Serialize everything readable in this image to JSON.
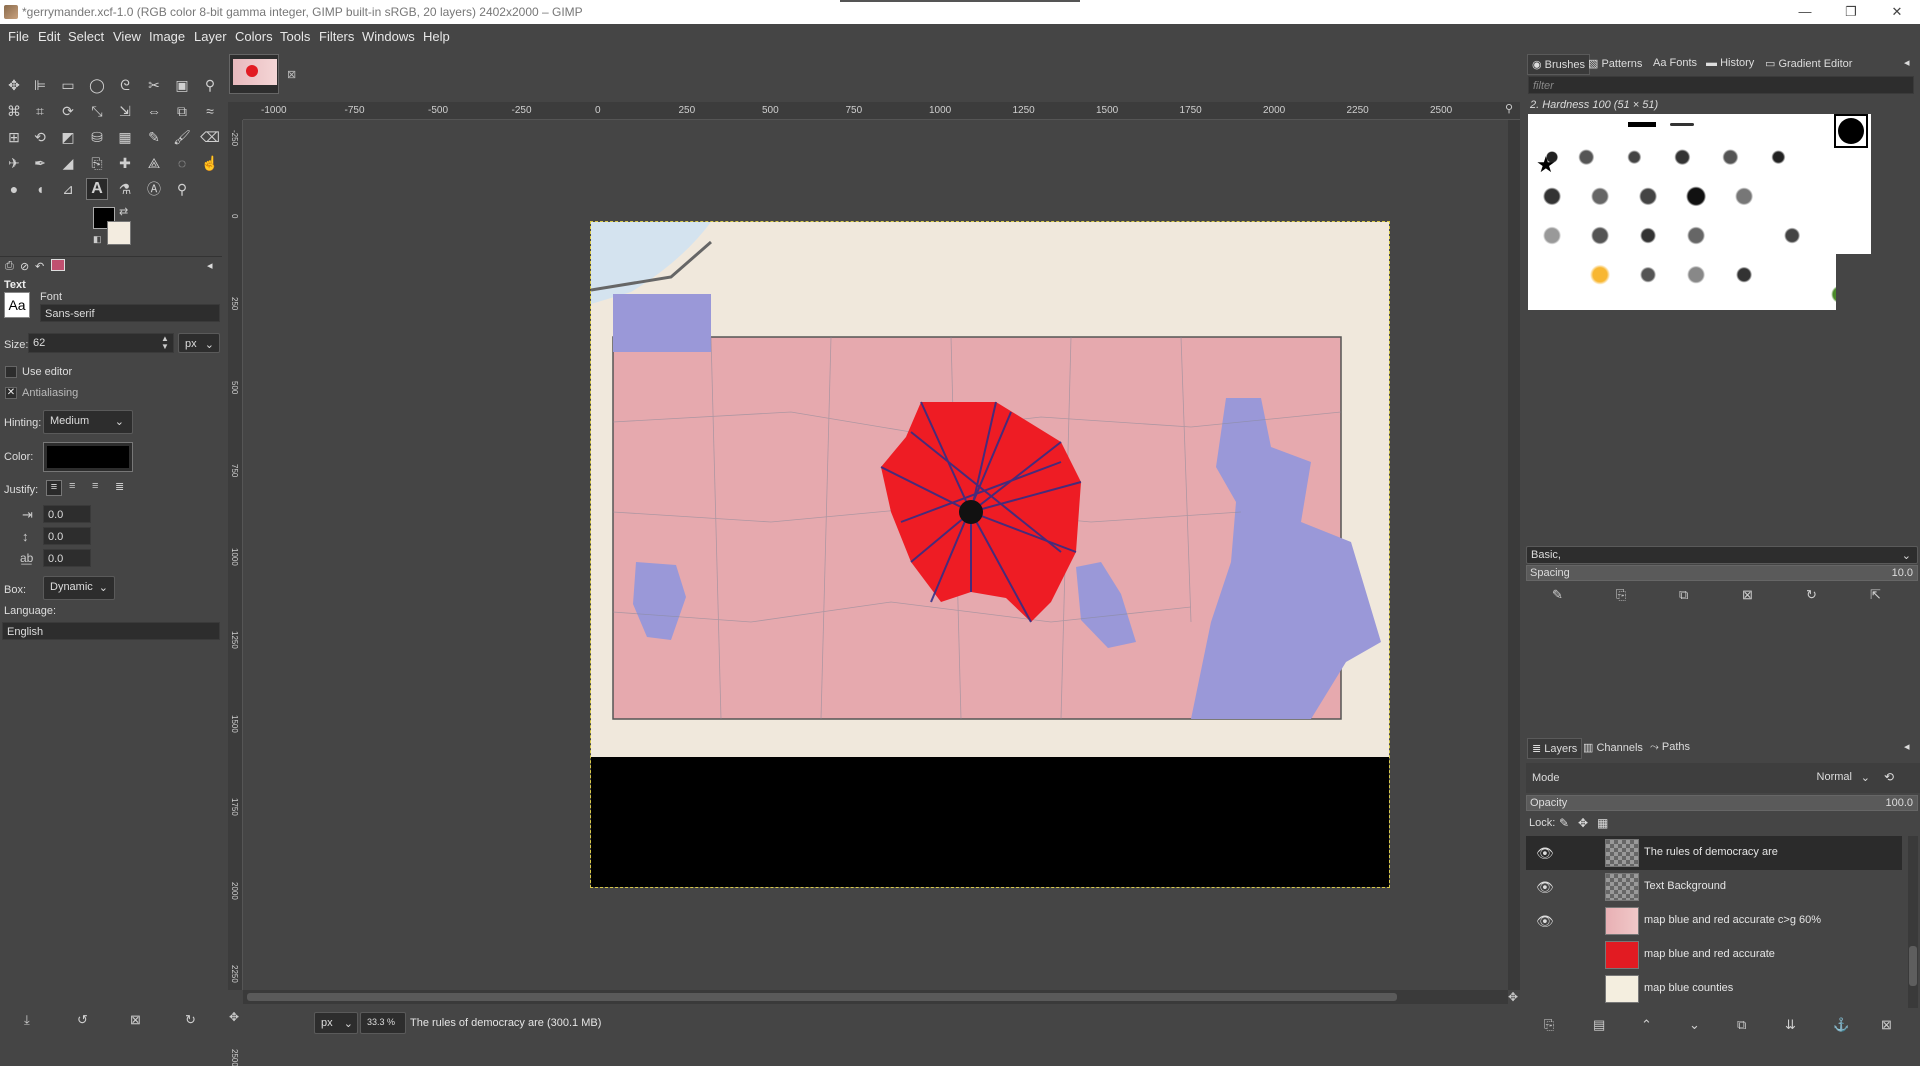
{
  "window": {
    "title": "*gerrymander.xcf-1.0 (RGB color 8-bit gamma integer, GIMP built-in sRGB, 20 layers) 2402x2000 – GIMP",
    "minimize": "—",
    "maximize": "❐",
    "close": "✕"
  },
  "menu": [
    "File",
    "Edit",
    "Select",
    "View",
    "Image",
    "Layer",
    "Colors",
    "Tools",
    "Filters",
    "Windows",
    "Help"
  ],
  "tool_options": {
    "section_title": "Text",
    "font_label": "Font",
    "font_value": "Sans-serif",
    "font_preview": "Aa",
    "size_label": "Size:",
    "size_value": "62",
    "size_unit": "px",
    "use_editor_label": "Use editor",
    "use_editor_checked": false,
    "antialiasing_label": "Antialiasing",
    "antialiasing_checked": true,
    "hinting_label": "Hinting:",
    "hinting_value": "Medium",
    "color_label": "Color:",
    "color_value": "#000000",
    "justify_label": "Justify:",
    "indent_value": "0.0",
    "line_spacing_value": "0.0",
    "letter_spacing_value": "0.0",
    "box_label": "Box:",
    "box_value": "Dynamic",
    "language_label": "Language:",
    "language_value": "English"
  },
  "ruler": {
    "h_labels": [
      "-1000",
      "-750",
      "-500",
      "-250",
      "0",
      "250",
      "500",
      "750",
      "1000",
      "1250",
      "1500",
      "1750",
      "2000",
      "2250",
      "2500"
    ],
    "v_labels": [
      "-250",
      "0",
      "250",
      "500",
      "750",
      "1000",
      "1250",
      "1500",
      "1750",
      "2000",
      "2250",
      "2500"
    ]
  },
  "status": {
    "unit": "px",
    "zoom": "33.3 %",
    "message": "The rules of democracy are (300.1 MB)"
  },
  "dock_top": {
    "tabs": [
      "Brushes",
      "Patterns",
      "Fonts",
      "History",
      "Gradient Editor"
    ],
    "filter_placeholder": "filter",
    "brush_name": "2. Hardness 100 (51 × 51)",
    "preset": "Basic,",
    "spacing_label": "Spacing",
    "spacing_value": "10.0"
  },
  "dock_bottom": {
    "tabs": [
      "Layers",
      "Channels",
      "Paths"
    ],
    "mode_label": "Mode",
    "mode_value": "Normal",
    "opacity_label": "Opacity",
    "opacity_value": "100.0",
    "lock_label": "Lock:",
    "layers": [
      {
        "name": "The rules of democracy are",
        "visible": true,
        "selected": true
      },
      {
        "name": "Text Background",
        "visible": true,
        "selected": false
      },
      {
        "name": "map blue and red accurate c>g 60%",
        "visible": true,
        "selected": false
      },
      {
        "name": "map blue and red accurate",
        "visible": false,
        "selected": false
      },
      {
        "name": "map blue counties",
        "visible": false,
        "selected": false
      }
    ]
  },
  "colors": {
    "accent_selection": "#d8c84a",
    "foreground": "#000000",
    "background": "#f3ece0"
  }
}
